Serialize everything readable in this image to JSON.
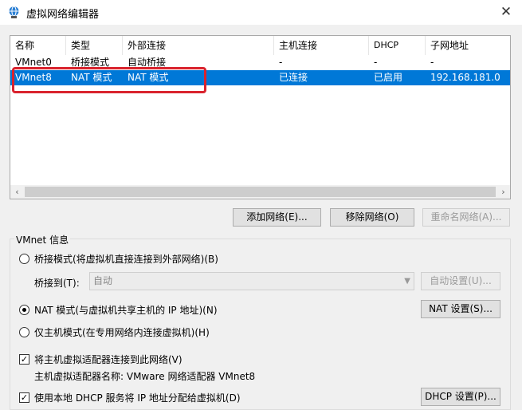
{
  "window": {
    "title": "虚拟网络编辑器",
    "close_glyph": "✕"
  },
  "table": {
    "columns": [
      "名称",
      "类型",
      "外部连接",
      "主机连接",
      "DHCP",
      "子网地址"
    ],
    "rows": [
      [
        "VMnet0",
        "桥接模式",
        "自动桥接",
        "-",
        "-",
        "-"
      ],
      [
        "VMnet8",
        "NAT 模式",
        "NAT 模式",
        "已连接",
        "已启用",
        "192.168.181.0"
      ]
    ],
    "selected_row": 1,
    "scroll_left": "‹",
    "scroll_right": "›"
  },
  "buttons": {
    "add_network": "添加网络(E)...",
    "remove_network": "移除网络(O)",
    "rename_network": "重命名网络(A)..."
  },
  "info": {
    "group_label": "VMnet 信息",
    "bridged_mode": "桥接模式(将虚拟机直接连接到外部网络)(B)",
    "bridged_to_label": "桥接到(T):",
    "bridged_to_value": "自动",
    "auto_settings": "自动设置(U)...",
    "nat_mode": "NAT 模式(与虚拟机共享主机的 IP 地址)(N)",
    "nat_settings": "NAT 设置(S)...",
    "host_only": "仅主机模式(在专用网络内连接虚拟机)(H)",
    "connect_adapter": "将主机虚拟适配器连接到此网络(V)",
    "adapter_name": "主机虚拟适配器名称: VMware 网络适配器 VMnet8",
    "use_dhcp": "使用本地 DHCP 服务将 IP 地址分配给虚拟机(D)",
    "dhcp_settings": "DHCP 设置(P)...",
    "check_glyph": "✓"
  },
  "colors": {
    "selection": "#0078d7",
    "highlight_box": "#d9232e"
  }
}
